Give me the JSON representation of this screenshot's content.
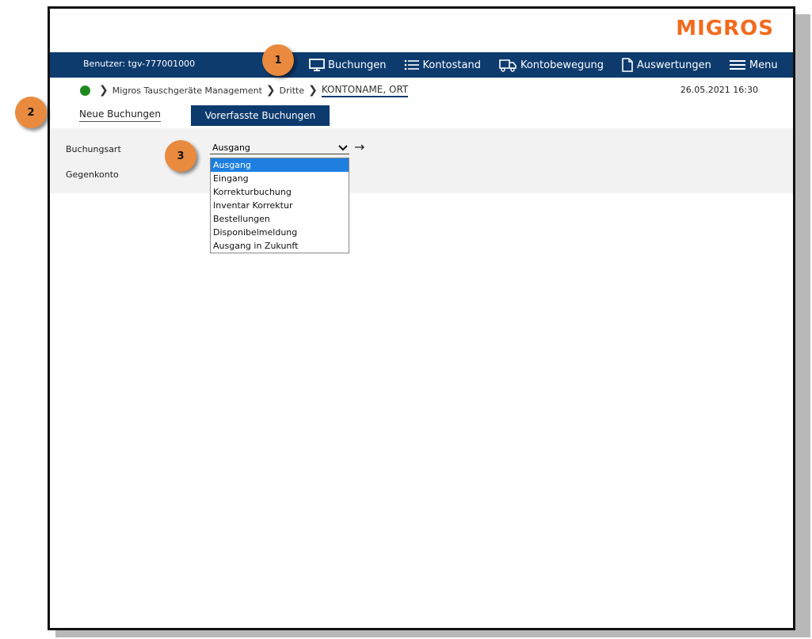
{
  "brand": {
    "logo_text": "MIGROS",
    "accent": "#f26b1d",
    "navy": "#0d3b6e"
  },
  "header": {
    "user_label": "Benutzer: tgv-777001000",
    "nav": [
      {
        "label": "Buchungen",
        "icon": "monitor-icon"
      },
      {
        "label": "Kontostand",
        "icon": "list-icon"
      },
      {
        "label": "Kontobewegung",
        "icon": "truck-icon"
      },
      {
        "label": "Auswertungen",
        "icon": "document-icon"
      },
      {
        "label": "Menu",
        "icon": "hamburger-icon"
      }
    ]
  },
  "breadcrumb": {
    "status_color": "#1e8a1e",
    "items": [
      "Migros Tauschgeräte Management",
      "Dritte",
      "KONTONAME, ORT"
    ],
    "datetime": "26.05.2021 16:30"
  },
  "tabs": [
    {
      "label": "Neue Buchungen",
      "active": true
    },
    {
      "label": "Vorerfasste Buchungen",
      "active": false
    }
  ],
  "form": {
    "buchungsart_label": "Buchungsart",
    "gegenkonto_label": "Gegenkonto",
    "selected": "Ausgang",
    "options": [
      "Ausgang",
      "Eingang",
      "Korrekturbuchung",
      "Inventar Korrektur",
      "Bestellungen",
      "Disponibelmeldung",
      "Ausgang in Zukunft"
    ]
  },
  "badges": [
    "1",
    "2",
    "3"
  ]
}
